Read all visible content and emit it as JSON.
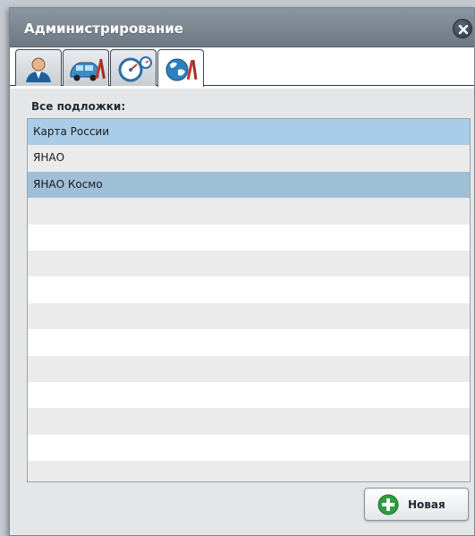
{
  "window": {
    "title": "Администрирование"
  },
  "tabs": [
    {
      "icon": "user-icon"
    },
    {
      "icon": "car-settings-icon"
    },
    {
      "icon": "speedometer-icon"
    },
    {
      "icon": "globe-tools-icon",
      "active": true
    }
  ],
  "section": {
    "label": "Все подложки:"
  },
  "list": {
    "items": [
      "Карта России",
      "ЯНАО",
      "ЯНАО Космо",
      "",
      "",
      "",
      "",
      "",
      "",
      "",
      "",
      "",
      "",
      ""
    ]
  },
  "actions": {
    "new_label": "Новая"
  },
  "colors": {
    "titlebar": "#7a848f",
    "selected_row": "#a9cce8",
    "accent_green": "#2e9e3f"
  }
}
